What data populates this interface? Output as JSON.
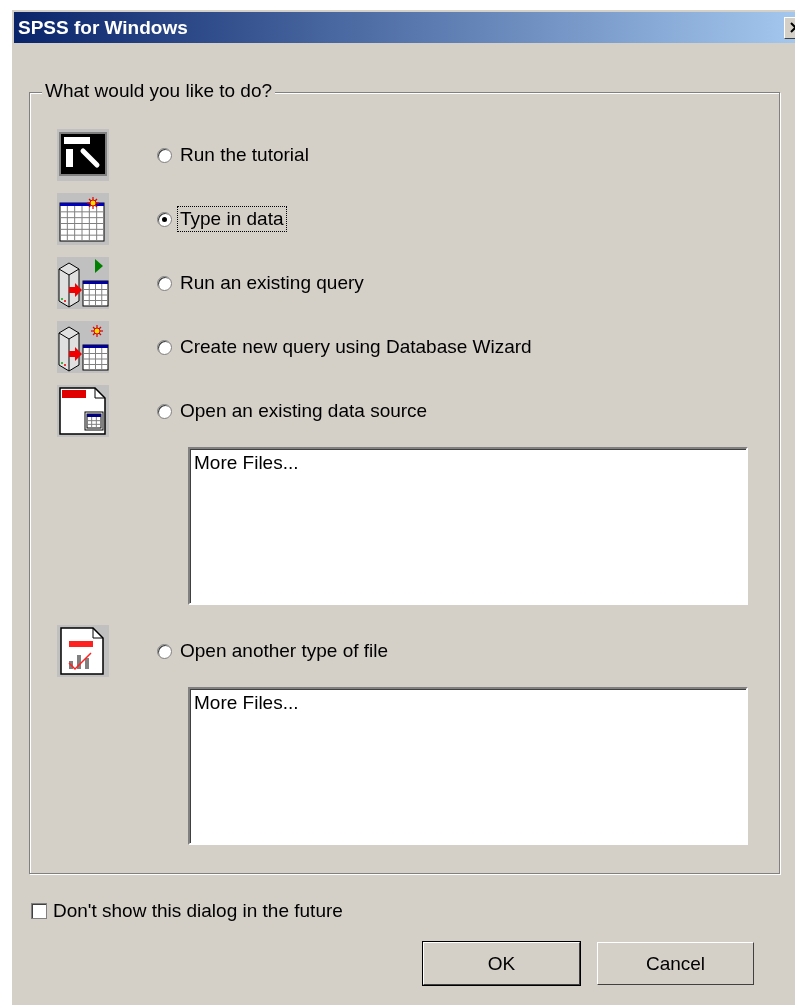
{
  "window": {
    "title": "SPSS for Windows"
  },
  "group": {
    "legend": "What would you like to do?"
  },
  "options": [
    {
      "label": "Run the tutorial",
      "selected": false,
      "focused": false,
      "kind": "lesson"
    },
    {
      "label": "Type in data",
      "selected": true,
      "focused": true,
      "kind": "grid"
    },
    {
      "label": "Run an existing query",
      "selected": false,
      "focused": false,
      "kind": "db-run"
    },
    {
      "label": "Create new query using Database Wizard",
      "selected": false,
      "focused": false,
      "kind": "db-new"
    },
    {
      "label": "Open an existing data source",
      "selected": false,
      "focused": false,
      "kind": "spss-doc",
      "files": [
        "More Files..."
      ]
    },
    {
      "label": "Open another type of file",
      "selected": false,
      "focused": false,
      "kind": "spss-chart",
      "files": [
        "More Files..."
      ]
    }
  ],
  "dont_show": {
    "label": "Don't show this dialog in the future",
    "checked": false
  },
  "buttons": [
    {
      "label": "OK",
      "default": true
    },
    {
      "label": "Cancel",
      "default": false
    }
  ]
}
